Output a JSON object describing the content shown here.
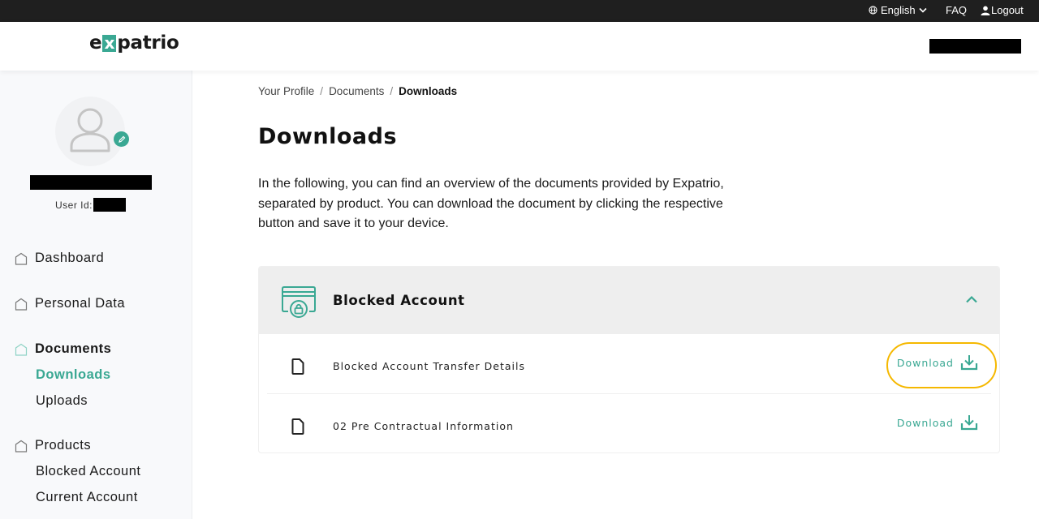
{
  "topbar": {
    "language": "English",
    "faq": "FAQ",
    "logout": "Logout"
  },
  "header": {
    "logo_prefix": "e",
    "logo_x": "x",
    "logo_suffix": "patrio"
  },
  "sidebar": {
    "user_id_label": "User Id:",
    "nav": [
      {
        "label": "Dashboard"
      },
      {
        "label": "Personal Data"
      },
      {
        "label": "Documents",
        "children": [
          {
            "label": "Downloads"
          },
          {
            "label": "Uploads"
          }
        ]
      },
      {
        "label": "Products",
        "children": [
          {
            "label": "Blocked Account"
          },
          {
            "label": "Current Account"
          }
        ]
      }
    ]
  },
  "breadcrumb": [
    "Your Profile",
    "Documents",
    "Downloads"
  ],
  "page": {
    "title": "Downloads",
    "intro": "In the following, you can find an overview of the documents provided by Expatrio, separated by product. You can download the document by clicking the respective button and save it to your device."
  },
  "panel": {
    "title": "Blocked Account",
    "expanded": true,
    "documents": [
      {
        "name": "Blocked Account Transfer Details",
        "action": "Download"
      },
      {
        "name": "02 Pre Contractual Information",
        "action": "Download"
      }
    ]
  },
  "colors": {
    "accent": "#3aa893",
    "highlight": "#f5b800",
    "topbar": "#1f1f1f"
  }
}
